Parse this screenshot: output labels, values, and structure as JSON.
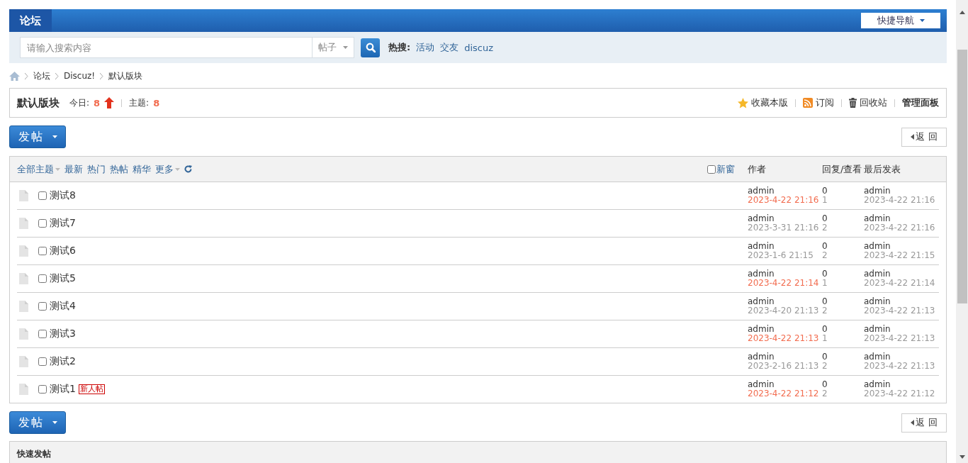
{
  "nav": {
    "tabs": [
      {
        "label": "论坛",
        "selected": true
      }
    ],
    "quick_nav": "快捷导航"
  },
  "search": {
    "placeholder": "请输入搜索内容",
    "scope": "帖子",
    "hot_label": "热搜:",
    "hot_terms": [
      "活动",
      "交友",
      "discuz"
    ]
  },
  "breadcrumb": [
    "论坛",
    "Discuz!",
    "默认版块"
  ],
  "forum": {
    "name": "默认版块",
    "today_label": "今日:",
    "today": "8",
    "trend_up": true,
    "threads_label": "主题:",
    "threads": "8",
    "actions": [
      {
        "kind": "favorite",
        "label": "收藏本版"
      },
      {
        "kind": "rss",
        "label": "订阅"
      },
      {
        "kind": "trash",
        "label": "回收站"
      },
      {
        "kind": "admin",
        "label": "管理面板"
      }
    ]
  },
  "action_bars": [
    {
      "post_button": "发帖",
      "back_button": "返 回"
    },
    {
      "post_button": "发帖",
      "back_button": "返 回"
    }
  ],
  "thread_list": {
    "filters": [
      {
        "label": "全部主题",
        "dropdown": true
      },
      {
        "label": "最新",
        "dropdown": false
      },
      {
        "label": "热门",
        "dropdown": false
      },
      {
        "label": "热帖",
        "dropdown": false
      },
      {
        "label": "精华",
        "dropdown": false
      },
      {
        "label": "更多",
        "dropdown": true
      }
    ],
    "new_window": {
      "label": "新窗",
      "checked": false
    },
    "columns": [
      "作者",
      "回复/查看",
      "最后发表"
    ],
    "rows": [
      {
        "title": "测试8",
        "checked": false,
        "author": "admin",
        "date": "2023-4-22 21:16",
        "recent": true,
        "replies": "0",
        "views": "1",
        "last_author": "admin",
        "last_date": "2023-4-22 21:16"
      },
      {
        "title": "测试7",
        "checked": false,
        "author": "admin",
        "date": "2023-3-31 21:16",
        "recent": false,
        "replies": "0",
        "views": "2",
        "last_author": "admin",
        "last_date": "2023-4-22 21:16"
      },
      {
        "title": "测试6",
        "checked": false,
        "author": "admin",
        "date": "2023-1-6 21:15",
        "recent": false,
        "replies": "0",
        "views": "2",
        "last_author": "admin",
        "last_date": "2023-4-22 21:15"
      },
      {
        "title": "测试5",
        "checked": false,
        "author": "admin",
        "date": "2023-4-22 21:14",
        "recent": true,
        "replies": "0",
        "views": "1",
        "last_author": "admin",
        "last_date": "2023-4-22 21:14"
      },
      {
        "title": "测试4",
        "checked": false,
        "author": "admin",
        "date": "2023-4-20 21:13",
        "recent": false,
        "replies": "0",
        "views": "2",
        "last_author": "admin",
        "last_date": "2023-4-22 21:13"
      },
      {
        "title": "测试3",
        "checked": false,
        "author": "admin",
        "date": "2023-4-22 21:13",
        "recent": true,
        "replies": "0",
        "views": "1",
        "last_author": "admin",
        "last_date": "2023-4-22 21:13"
      },
      {
        "title": "测试2",
        "checked": false,
        "author": "admin",
        "date": "2023-2-16 21:13",
        "recent": false,
        "replies": "0",
        "views": "2",
        "last_author": "admin",
        "last_date": "2023-4-22 21:13"
      },
      {
        "title": "测试1",
        "checked": false,
        "badge": "新人帖",
        "author": "admin",
        "date": "2023-4-22 21:12",
        "recent": true,
        "replies": "0",
        "views": "2",
        "last_author": "admin",
        "last_date": "2023-4-22 21:12"
      }
    ]
  },
  "quick_post": {
    "title": "快速发帖"
  }
}
